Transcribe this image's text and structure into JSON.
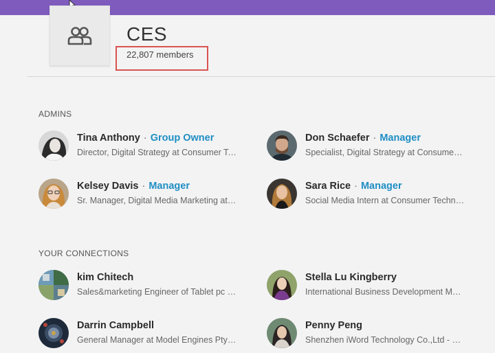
{
  "group": {
    "title": "CES",
    "members": "22,807 members",
    "icon": "group-people-icon"
  },
  "admins": {
    "heading": "ADMINS",
    "people": [
      {
        "name": "Tina Anthony",
        "sep": "·",
        "role": "Group Owner",
        "title": "Director, Digital Strategy at Consumer Technology Association"
      },
      {
        "name": "Don Schaefer",
        "sep": "·",
        "role": "Manager",
        "title": "Specialist, Digital Strategy at Consumer Technology Association"
      },
      {
        "name": "Kelsey Davis",
        "sep": "·",
        "role": "Manager",
        "title": "Sr. Manager, Digital Media Marketing at Consumer Technology Association"
      },
      {
        "name": "Sara Rice",
        "sep": "·",
        "role": "Manager",
        "title": "Social Media Intern at Consumer Technology Association"
      }
    ]
  },
  "connections": {
    "heading": "YOUR CONNECTIONS",
    "people": [
      {
        "name": "kim Chitech",
        "title": "Sales&marketing Engineer of Tablet pc and phone"
      },
      {
        "name": "Stella Lu Kingberry",
        "title": "International Business Development Manager"
      },
      {
        "name": "Darrin Campbell",
        "title": "General Manager at Model Engines Pty Ltd"
      },
      {
        "name": "Penny Peng",
        "title": "Shenzhen iWord Technology Co.,Ltd - Sales Manager"
      }
    ]
  },
  "colors": {
    "topbar": "#7e5bbd",
    "role_link": "#1f8ec4",
    "highlight_box": "#d9534f"
  }
}
